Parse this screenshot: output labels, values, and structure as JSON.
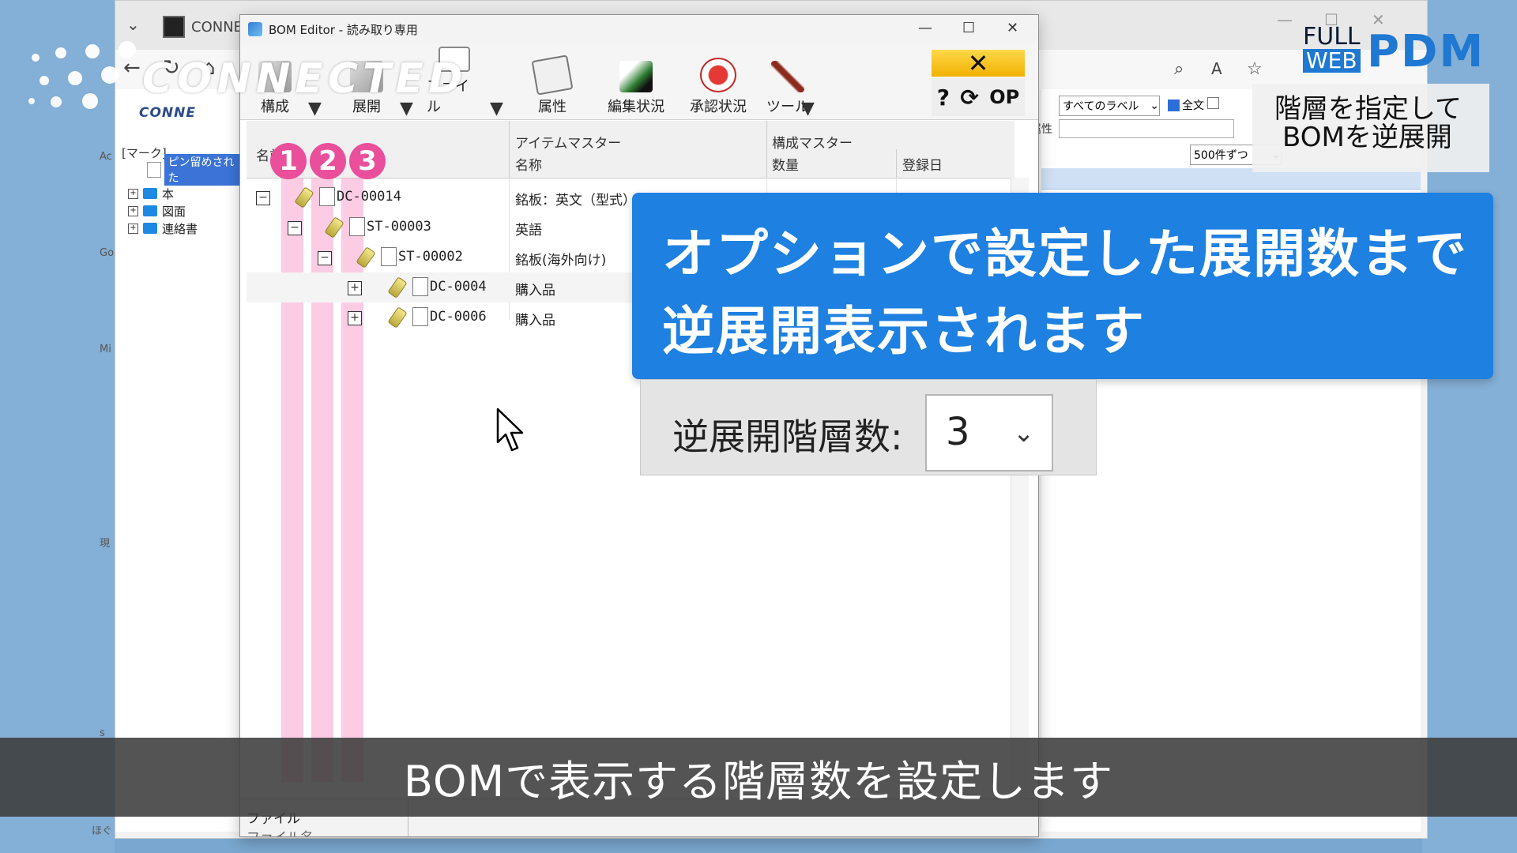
{
  "background_browser": {
    "tab_title": "CONNE",
    "sidebar_logo": "CONNE",
    "mark_label": "[マーク]",
    "pinned_label": "ピン留めされた",
    "tree_items": [
      "本",
      "図面",
      "連絡書"
    ],
    "side_letters": [
      "Ac",
      "Go",
      "Mi",
      "現",
      "s",
      "ほぐ"
    ],
    "label_select": "すべてのラベル",
    "fulltext_checkbox": "全文",
    "attr_label": "属性",
    "count_select": "500件ずつ"
  },
  "bom_editor": {
    "title": "BOM Editor - 読み取り専用",
    "toolbar": {
      "kosei": "構成",
      "tenkai": "展開",
      "file": "ファイル",
      "attribute": "属性",
      "edit_status": "編集状況",
      "approval_status": "承認状況",
      "tools": "ツール",
      "close_symbol": "✕",
      "help": "?",
      "refresh": "⟳",
      "op": "OP"
    },
    "grid": {
      "group_headers": [
        "アイテムマスター",
        "構成マスター"
      ],
      "columns": [
        "名前",
        "名称",
        "数量",
        "登録日"
      ],
      "level_badges": [
        "1",
        "2",
        "3"
      ],
      "rows": [
        {
          "name": "DC-00014",
          "description": "銘板：英文（型式）",
          "expander": "−"
        },
        {
          "name": "ST-00003",
          "description": "英語",
          "expander": "−"
        },
        {
          "name": "ST-00002",
          "description": "銘板(海外向け)",
          "expander": "−"
        },
        {
          "name": "DC-0004",
          "description": "購入品",
          "expander": "+"
        },
        {
          "name": "DC-0006",
          "description": "購入品",
          "expander": "+"
        }
      ]
    },
    "bottom_panel": {
      "label": "ファイル",
      "label2": "ファイル名"
    }
  },
  "callout": {
    "line1": "オプションで設定した展開数まで",
    "line2": "逆展開表示されます"
  },
  "zoom_panel": {
    "label": "逆展開階層数:",
    "value": "3"
  },
  "subtitle": "BOMで表示する階層数を設定します",
  "brand": {
    "full": "FULL",
    "web": "WEB",
    "pdm": "PDM",
    "caption_line1": "階層を指定して",
    "caption_line2": "BOMを逆展開"
  },
  "watermark": "CONNECTED",
  "colors": {
    "callout_bg": "#1e80e0",
    "badge_pink": "#ea4f9b",
    "level_highlight": "#faaad2",
    "brand_blue": "#1f78d1"
  }
}
